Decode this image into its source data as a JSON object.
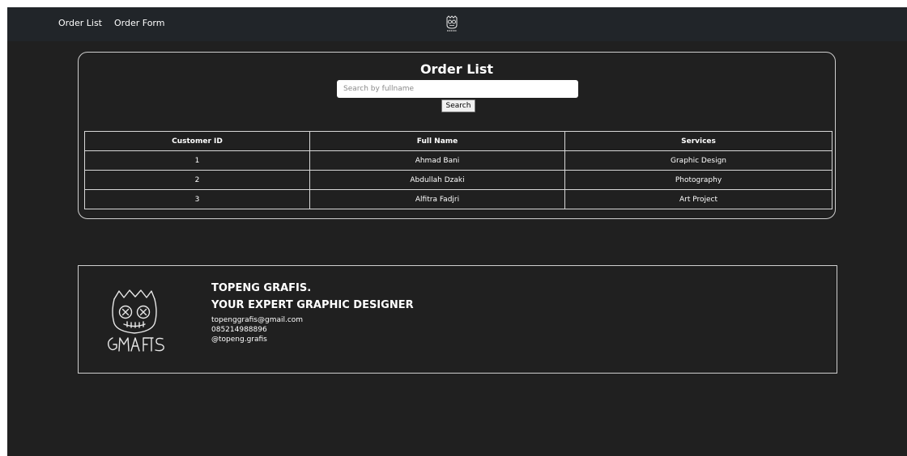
{
  "nav": {
    "links": [
      "Order List",
      "Order Form"
    ],
    "logo_icon": "mask-logo-icon"
  },
  "order_list": {
    "title": "Order List",
    "search": {
      "placeholder": "Search by fullname",
      "value": "",
      "button_label": "Search"
    },
    "table": {
      "headers": [
        "Customer ID",
        "Full Name",
        "Services"
      ],
      "rows": [
        [
          "1",
          "Ahmad Bani",
          "Graphic Design"
        ],
        [
          "2",
          "Abdullah Dzaki",
          "Photography"
        ],
        [
          "3",
          "Alfitra Fadjri",
          "Art Project"
        ]
      ]
    }
  },
  "footer": {
    "logo_icon": "grafis-mask-logo-icon",
    "brand": "TOPENG GRAFIS.",
    "tagline": "YOUR EXPERT GRAPHIC DESIGNER",
    "email": "topenggrafis@gmail.com",
    "phone": "085214988896",
    "social": "@topeng.grafis"
  },
  "colors": {
    "page_background": "#202020",
    "navbar_background": "#212529",
    "text": "#ffffff",
    "border": "#cfcfcf"
  }
}
